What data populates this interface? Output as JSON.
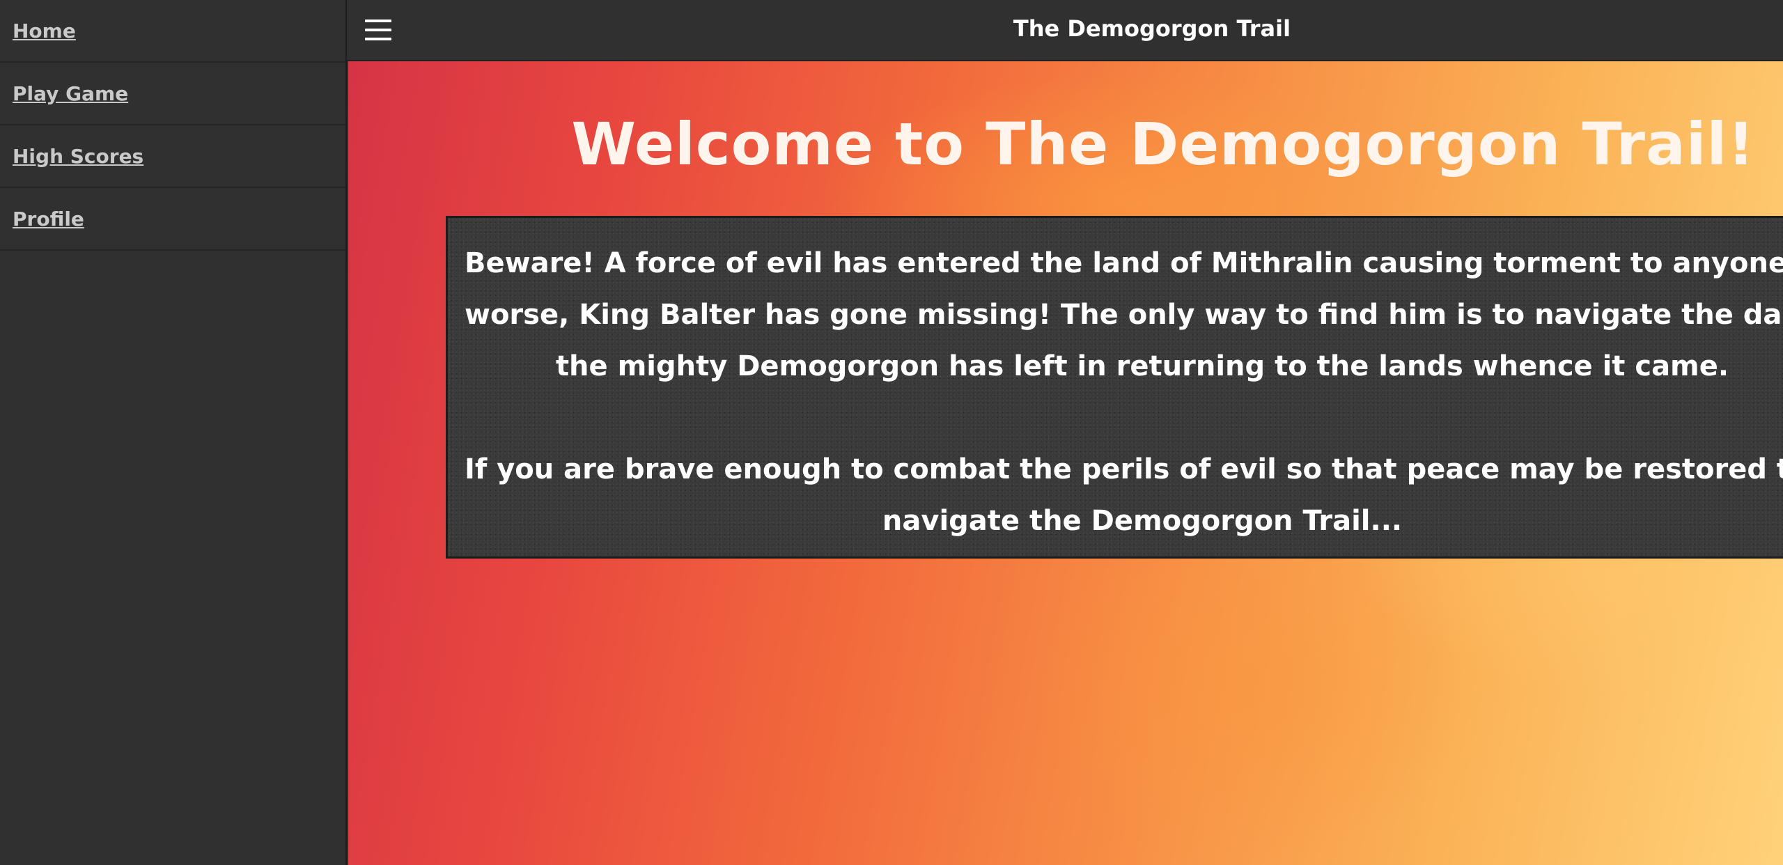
{
  "sidebar": {
    "items": [
      {
        "label": "Home"
      },
      {
        "label": "Play Game"
      },
      {
        "label": "High Scores"
      },
      {
        "label": "Profile"
      }
    ]
  },
  "topbar": {
    "menu_icon": "hamburger-menu-icon",
    "title": "The Demogorgon Trail"
  },
  "main": {
    "heading": "Welcome to The Demogorgon Trail!",
    "story": {
      "line1": "Beware! A force of evil has entered the land of Mithralin causing torment to anyone who resis",
      "line2": "worse, King Balter has gone missing! The only way to find him is to navigate the daunting trail of",
      "line3": "the mighty Demogorgon has left in returning to the lands whence it came.",
      "line4": "If you are brave enough to combat the perils of evil so that peace may be restored to these lands,",
      "line5": "navigate the Demogorgon Trail..."
    }
  },
  "colors": {
    "sidebar_bg": "#303030",
    "topbar_bg": "#303030",
    "link_color": "#c9c9c9",
    "story_box_bg": "#3a3a3a",
    "gradient_start": "#d63445",
    "gradient_end": "#ffd27a"
  }
}
